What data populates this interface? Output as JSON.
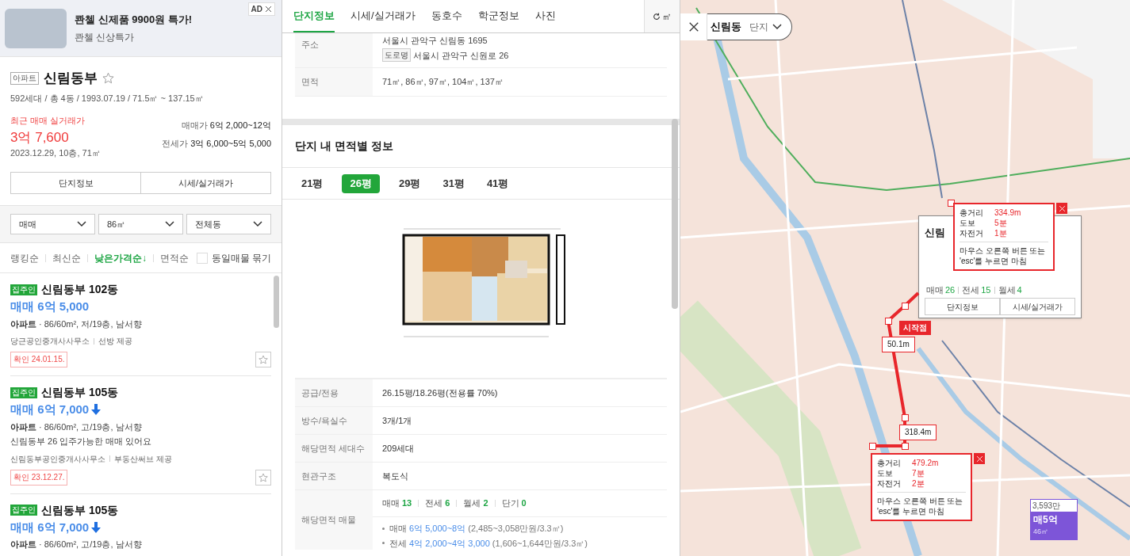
{
  "ad": {
    "badge": "AD",
    "headline": "콴첼 신제품 9900원 특가!",
    "subline": "콴첼 신상특가"
  },
  "complex": {
    "type_tag": "아파트",
    "name": "신림동부",
    "favorite": false,
    "summary": "592세대 / 총 4동 / 1993.07.19 / 71.5㎡ ~ 137.15㎡",
    "recent_label": "최근 매매 실거래가",
    "recent_price": "3억 7,600",
    "recent_detail": "2023.12.29, 10층, 71㎡",
    "sale_label": "매매가",
    "sale_range": "6억 2,000~12억",
    "jeonse_label": "전세가",
    "jeonse_range": "3억 6,000~5억 5,000",
    "buttons": [
      "단지정보",
      "시세/실거래가"
    ]
  },
  "filters": [
    "매매",
    "86㎡",
    "전체동"
  ],
  "sort_options": [
    {
      "label": "랭킹순",
      "selected": false
    },
    {
      "label": "최신순",
      "selected": false
    },
    {
      "label": "낮은가격순↓",
      "selected": true
    },
    {
      "label": "면적순",
      "selected": false
    }
  ],
  "group_same": {
    "label": "동일매물 묶기",
    "checked": false
  },
  "listings": [
    {
      "badge": "집주인",
      "title": "신림동부 102동",
      "price": "매매 6억 5,000",
      "price_down": false,
      "spec_type": "아파트",
      "spec": "· 86/60m², 저/19층, 남서향",
      "agency": "당근공인중개사사무소",
      "provider": "선방 제공",
      "confirmed": "확인 24.01.15.",
      "favorite": false
    },
    {
      "badge": "집주인",
      "title": "신림동부 105동",
      "price": "매매 6억 7,000",
      "price_down": true,
      "spec_type": "아파트",
      "spec": "· 86/60m², 고/19층, 남서향",
      "description": "신림동부 26 입주가능한 매매 있어요",
      "agency": "신림동부공인중개사사무소",
      "provider": "부동산써브 제공",
      "confirmed": "확인 23.12.27.",
      "favorite": false
    },
    {
      "badge": "집주인",
      "title": "신림동부 105동",
      "price": "매매 6억 7,000",
      "price_down": true,
      "spec_type": "아파트",
      "spec": "· 86/60m², 고/19층, 남서향"
    }
  ],
  "detail_tabs": [
    {
      "label": "단지정보",
      "selected": true
    },
    {
      "label": "시세/실거래가",
      "selected": false
    },
    {
      "label": "동호수",
      "selected": false
    },
    {
      "label": "학군정보",
      "selected": false
    },
    {
      "label": "사진",
      "selected": false
    }
  ],
  "unit_toggle": "㎡",
  "address": {
    "label": "주소",
    "lot": "서울시 관악구 신림동 1695",
    "road_tag": "도로명",
    "road": "서울시 관악구 신원로 26"
  },
  "area_row": {
    "label": "면적",
    "value": "71㎡, 86㎡, 97㎡, 104㎡, 137㎡"
  },
  "section_title": "단지 내 면적별 정보",
  "pyeong_tabs": [
    {
      "label": "21평",
      "selected": false
    },
    {
      "label": "26평",
      "selected": true
    },
    {
      "label": "29평",
      "selected": false
    },
    {
      "label": "31평",
      "selected": false
    },
    {
      "label": "41평",
      "selected": false
    }
  ],
  "specs": [
    {
      "label": "공급/전용",
      "value": "26.15평/18.26평(전용률 70%)"
    },
    {
      "label": "방수/욕실수",
      "value": "3개/1개"
    },
    {
      "label": "해당면적 세대수",
      "value": "209세대"
    },
    {
      "label": "현관구조",
      "value": "복도식"
    }
  ],
  "listings_row": {
    "label": "해당면적 매물",
    "counts": [
      {
        "label": "매매",
        "value": "13"
      },
      {
        "label": "전세",
        "value": "6"
      },
      {
        "label": "월세",
        "value": "2"
      },
      {
        "label": "단기",
        "value": "0"
      }
    ],
    "ranges": [
      {
        "label": "매매",
        "range": "6억 5,000~8억",
        "per_area": "(2,485~3,058만원/3.3㎡)"
      },
      {
        "label": "전세",
        "range": "4억 2,000~4억 3,000",
        "per_area": "(1,606~1,644만원/3.3㎡)"
      }
    ]
  },
  "map": {
    "area_chip": {
      "region": "신림동",
      "mode": "단지"
    },
    "complex_card": {
      "title": "신림",
      "counts": [
        {
          "label": "매매",
          "value": "26"
        },
        {
          "label": "전세",
          "value": "15"
        },
        {
          "label": "월세",
          "value": "4"
        }
      ],
      "buttons": [
        "단지정보",
        "시세/실거래가"
      ]
    },
    "start_label": "시작점",
    "segment_labels": [
      "50.1m",
      "318.4m"
    ],
    "distance_popups": [
      {
        "rows": [
          {
            "label": "총거리",
            "value": "334.9m"
          },
          {
            "label": "도보",
            "value": "5분"
          },
          {
            "label": "자전거",
            "value": "1분"
          }
        ],
        "hint": "마우스 오른쪽 버튼 또는 'esc'를 누르면 마침"
      },
      {
        "rows": [
          {
            "label": "총거리",
            "value": "479.2m"
          },
          {
            "label": "도보",
            "value": "7분"
          },
          {
            "label": "자전거",
            "value": "2분"
          }
        ],
        "hint": "마우스 오른쪽 버튼 또는 'esc'를 누르면 마침"
      }
    ],
    "price_marker": {
      "unit_price": "3,593만",
      "price": "매5억",
      "area": "46㎡"
    }
  }
}
